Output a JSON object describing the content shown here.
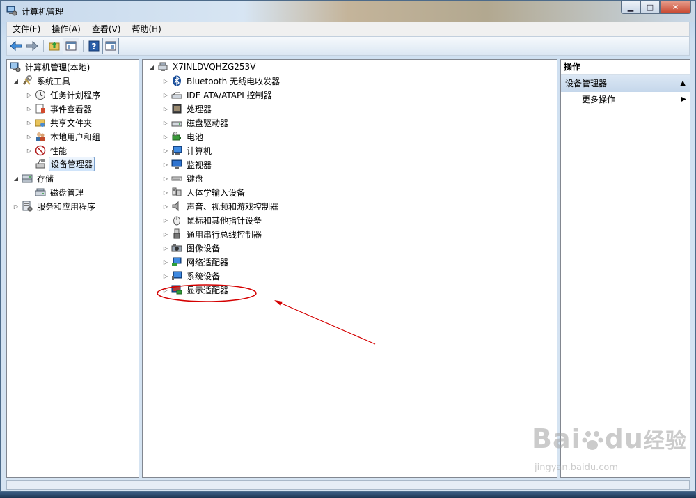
{
  "window": {
    "title": "计算机管理"
  },
  "menubar": [
    {
      "label": "文件(F)"
    },
    {
      "label": "操作(A)"
    },
    {
      "label": "查看(V)"
    },
    {
      "label": "帮助(H)"
    }
  ],
  "left_tree": [
    {
      "label": "计算机管理(本地)",
      "icon": "computer-management-icon"
    },
    {
      "label": "系统工具",
      "icon": "tools-icon"
    },
    {
      "label": "任务计划程序",
      "icon": "clock-icon"
    },
    {
      "label": "事件查看器",
      "icon": "event-viewer-icon"
    },
    {
      "label": "共享文件夹",
      "icon": "shared-folder-icon"
    },
    {
      "label": "本地用户和组",
      "icon": "users-icon"
    },
    {
      "label": "性能",
      "icon": "performance-icon"
    },
    {
      "label": "设备管理器",
      "icon": "device-manager-icon"
    },
    {
      "label": "存储",
      "icon": "storage-icon"
    },
    {
      "label": "磁盘管理",
      "icon": "disk-management-icon"
    },
    {
      "label": "服务和应用程序",
      "icon": "services-icon"
    }
  ],
  "device_tree": {
    "root": "X7INLDVQHZG253V",
    "items": [
      {
        "label": "Bluetooth 无线电收发器",
        "icon": "bluetooth-icon"
      },
      {
        "label": "IDE ATA/ATAPI 控制器",
        "icon": "ide-controller-icon"
      },
      {
        "label": "处理器",
        "icon": "processor-icon"
      },
      {
        "label": "磁盘驱动器",
        "icon": "disk-drive-icon"
      },
      {
        "label": "电池",
        "icon": "battery-icon"
      },
      {
        "label": "计算机",
        "icon": "computer-icon"
      },
      {
        "label": "监视器",
        "icon": "monitor-icon"
      },
      {
        "label": "键盘",
        "icon": "keyboard-icon"
      },
      {
        "label": "人体学输入设备",
        "icon": "hid-icon"
      },
      {
        "label": "声音、视频和游戏控制器",
        "icon": "sound-icon"
      },
      {
        "label": "鼠标和其他指针设备",
        "icon": "mouse-icon"
      },
      {
        "label": "通用串行总线控制器",
        "icon": "usb-icon"
      },
      {
        "label": "图像设备",
        "icon": "camera-icon"
      },
      {
        "label": "网络适配器",
        "icon": "network-adapter-icon"
      },
      {
        "label": "系统设备",
        "icon": "system-device-icon"
      },
      {
        "label": "显示适配器",
        "icon": "display-adapter-icon"
      }
    ]
  },
  "actions": {
    "header": "操作",
    "section": "设备管理器",
    "more": "更多操作"
  },
  "annotation": {
    "color": "#d40000"
  },
  "watermark": {
    "brand": "Bai",
    "brand2": "du",
    "cn": "经验",
    "url": "jingyan.baidu.com"
  }
}
